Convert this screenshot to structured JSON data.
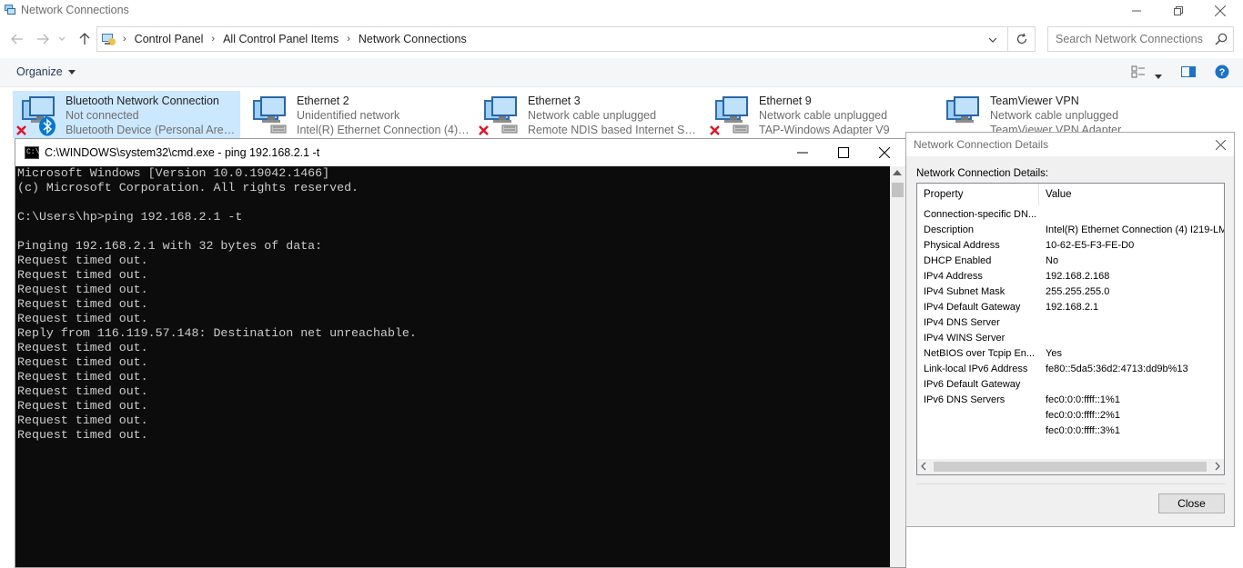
{
  "window": {
    "title": "Network Connections"
  },
  "address": {
    "crumbs": [
      "Control Panel",
      "All Control Panel Items",
      "Network Connections"
    ]
  },
  "search": {
    "placeholder": "Search Network Connections"
  },
  "commandbar": {
    "organize_label": "Organize"
  },
  "connections": [
    {
      "name": "Bluetooth Network Connection",
      "status": "Not connected",
      "device": "Bluetooth Device (Personal Area ...",
      "selected": true
    },
    {
      "name": "Ethernet 2",
      "status": "Unidentified network",
      "device": "Intel(R) Ethernet Connection (4) I..."
    },
    {
      "name": "Ethernet 3",
      "status": "Network cable unplugged",
      "device": "Remote NDIS based Internet Shari..."
    },
    {
      "name": "Ethernet 9",
      "status": "Network cable unplugged",
      "device": "TAP-Windows Adapter V9"
    },
    {
      "name": "TeamViewer VPN",
      "status": "Network cable unplugged",
      "device": "TeamViewer VPN Adapter"
    }
  ],
  "cmd": {
    "title": "C:\\WINDOWS\\system32\\cmd.exe - ping  192.168.2.1 -t",
    "icon_text": "C:\\",
    "lines": [
      "Microsoft Windows [Version 10.0.19042.1466]",
      "(c) Microsoft Corporation. All rights reserved.",
      "",
      "C:\\Users\\hp>ping 192.168.2.1 -t",
      "",
      "Pinging 192.168.2.1 with 32 bytes of data:",
      "Request timed out.",
      "Request timed out.",
      "Request timed out.",
      "Request timed out.",
      "Request timed out.",
      "Reply from 116.119.57.148: Destination net unreachable.",
      "Request timed out.",
      "Request timed out.",
      "Request timed out.",
      "Request timed out.",
      "Request timed out.",
      "Request timed out.",
      "Request timed out."
    ]
  },
  "details": {
    "title": "Network Connection Details",
    "label": "Network Connection Details:",
    "col_property": "Property",
    "col_value": "Value",
    "rows": [
      {
        "p": "Connection-specific DN...",
        "v": ""
      },
      {
        "p": "Description",
        "v": "Intel(R) Ethernet Connection (4) I219-LM"
      },
      {
        "p": "Physical Address",
        "v": "10-62-E5-F3-FE-D0"
      },
      {
        "p": "DHCP Enabled",
        "v": "No"
      },
      {
        "p": "IPv4 Address",
        "v": "192.168.2.168"
      },
      {
        "p": "IPv4 Subnet Mask",
        "v": "255.255.255.0"
      },
      {
        "p": "IPv4 Default Gateway",
        "v": "192.168.2.1"
      },
      {
        "p": "IPv4 DNS Server",
        "v": ""
      },
      {
        "p": "IPv4 WINS Server",
        "v": ""
      },
      {
        "p": "NetBIOS over Tcpip En...",
        "v": "Yes"
      },
      {
        "p": "Link-local IPv6 Address",
        "v": "fe80::5da5:36d2:4713:dd9b%13"
      },
      {
        "p": "IPv6 Default Gateway",
        "v": ""
      },
      {
        "p": "IPv6 DNS Servers",
        "v": "fec0:0:0:ffff::1%1"
      },
      {
        "p": "",
        "v": "fec0:0:0:ffff::2%1"
      },
      {
        "p": "",
        "v": "fec0:0:0:ffff::3%1"
      }
    ],
    "close_label": "Close"
  },
  "colors": {
    "selected_tile": "#cce8ff",
    "console_bg": "#0c0c0c",
    "console_fg": "#cccccc",
    "error_x": "#e81123",
    "bluetooth": "#0078d7"
  }
}
